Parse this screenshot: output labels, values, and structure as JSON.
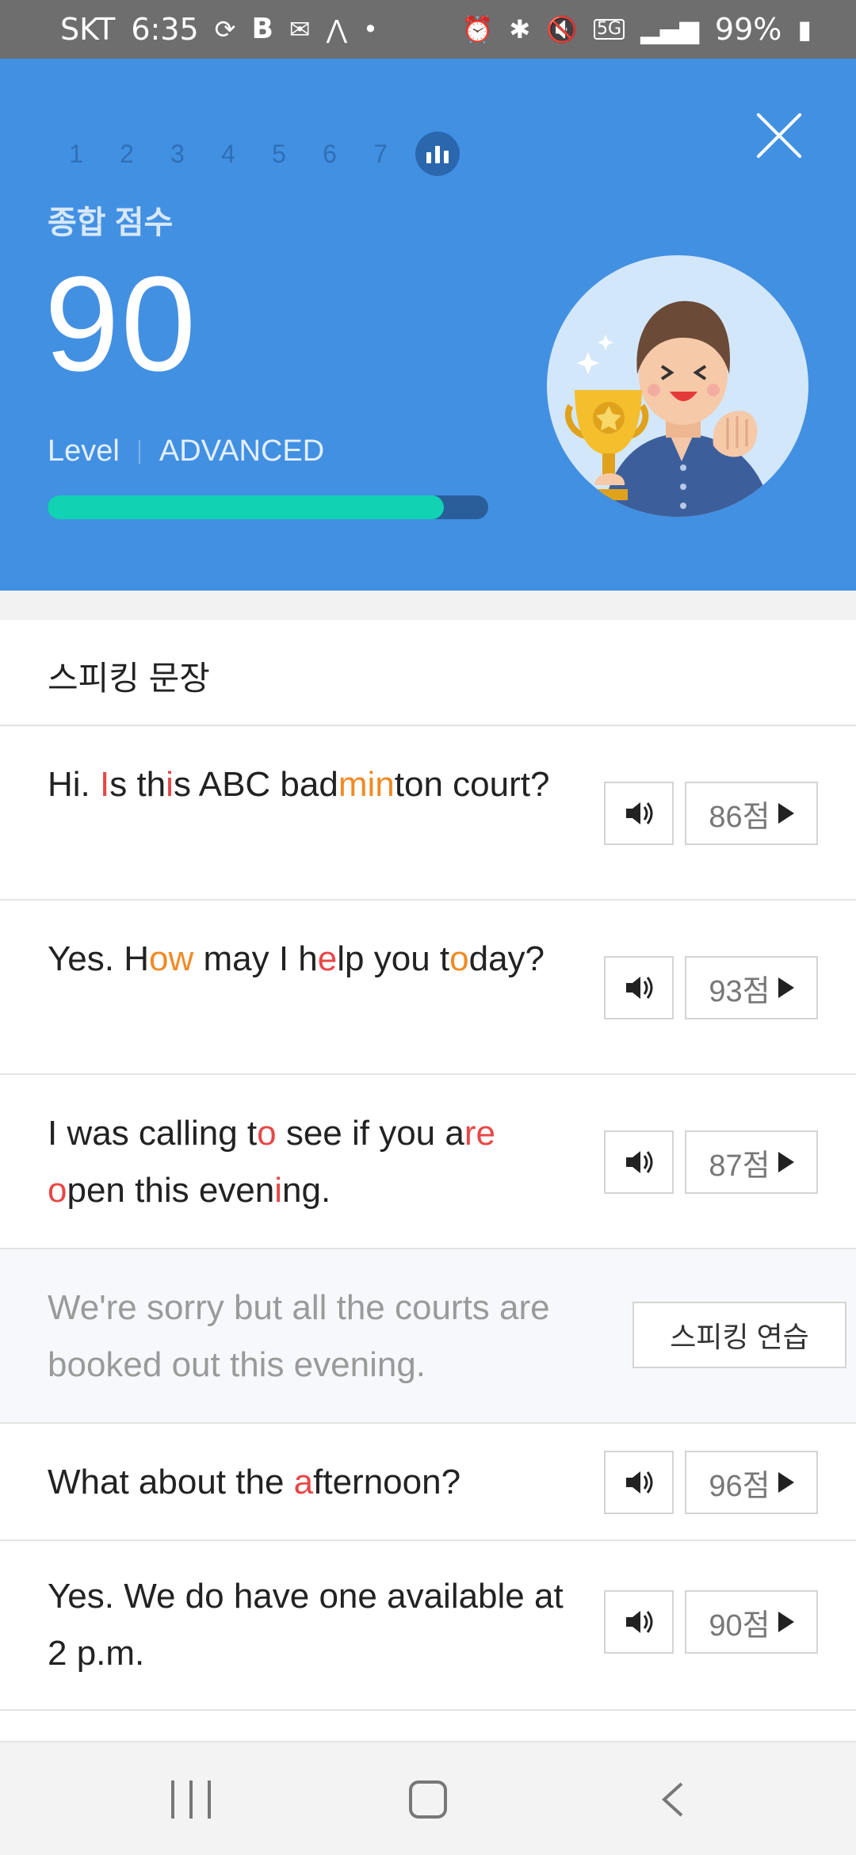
{
  "status_bar": {
    "carrier": "SKT",
    "time": "6:35",
    "battery": "99%",
    "network": "5G"
  },
  "header": {
    "steps": [
      "1",
      "2",
      "3",
      "4",
      "5",
      "6",
      "7"
    ],
    "score_label": "종합 점수",
    "score": "90",
    "level_label": "Level",
    "level_value": "ADVANCED",
    "progress_fraction": 0.9
  },
  "section": {
    "title": "스피킹 문장"
  },
  "sentences": [
    {
      "score": "86점"
    },
    {
      "score": "93점"
    },
    {
      "score": "87점"
    },
    {
      "practice_label": "스피킹 연습"
    },
    {
      "score": "96점"
    },
    {
      "score": "90점"
    }
  ],
  "colors": {
    "header_bg": "#4290e2",
    "progress_fill": "#11d3b4",
    "highlight_red": "#e84747",
    "highlight_orange": "#f08a24"
  }
}
